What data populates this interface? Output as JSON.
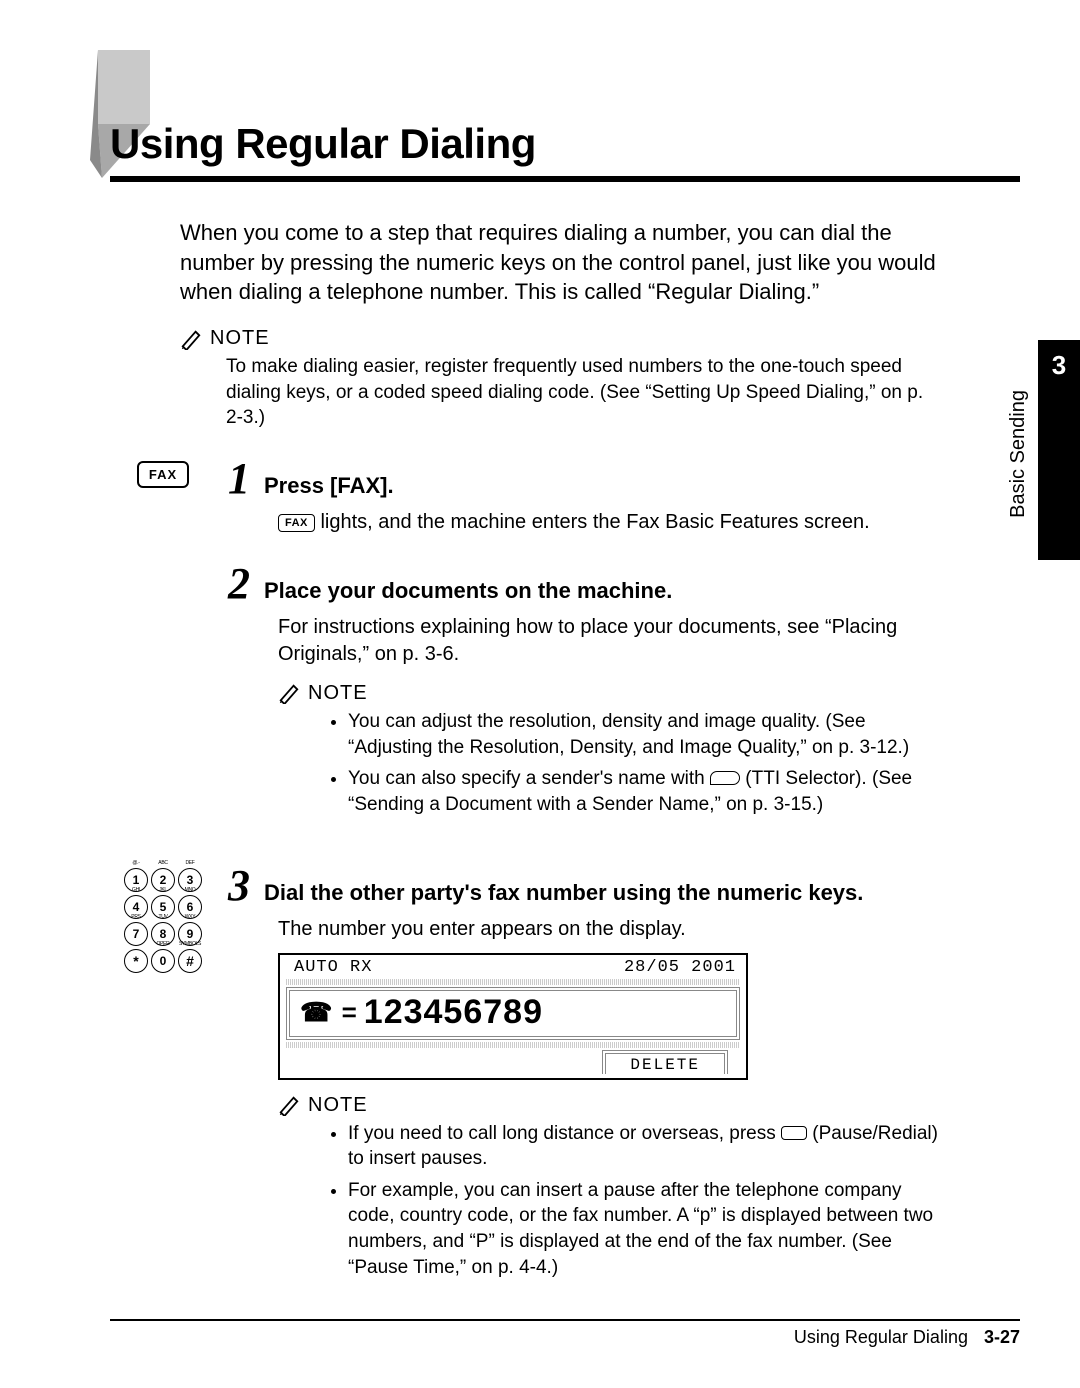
{
  "page": {
    "title": "Using Regular Dialing",
    "chapter_number": "3",
    "side_label": "Basic Sending",
    "footer_title": "Using Regular Dialing",
    "page_number": "3-27"
  },
  "intro": "When you come to a step that requires dialing a number, you can dial the number by pressing the numeric keys on the control panel, just like you would when dialing a telephone number. This is called “Regular Dialing.”",
  "note_label": "NOTE",
  "top_note": "To make dialing easier, register frequently used numbers to the one-touch speed dialing keys, or a coded speed dialing code. (See “Setting Up Speed Dialing,” on p. 2-3.)",
  "steps": [
    {
      "num": "1",
      "title": "Press [FAX].",
      "left_key_label": "FAX",
      "body_prefix_key": "FAX",
      "body_after_key": " lights, and the machine enters the Fax Basic Features screen."
    },
    {
      "num": "2",
      "title": "Place your documents on the machine.",
      "body": "For instructions explaining how to place your documents, see “Placing Originals,” on p. 3-6.",
      "note_items": [
        "You can adjust the resolution, density and image quality. (See “Adjusting the Resolution, Density, and Image Quality,” on p. 3-12.)",
        {
          "pre": "You can also specify a sender's name with ",
          "post": " (TTI Selector). (See “Sending a Document with a Sender Name,” on p. 3-15.)",
          "icon": "tti"
        }
      ]
    },
    {
      "num": "3",
      "title": "Dial the other party's fax number using the numeric keys.",
      "body": "The number you enter appears on the display.",
      "lcd": {
        "top_left": "AUTO RX",
        "top_right": "28/05 2001",
        "dial_prefix": "☎ =",
        "dial_number": "123456789",
        "softkey": "DELETE"
      },
      "note_items": [
        {
          "pre": "If you need to call long distance or overseas, press ",
          "post": " (Pause/Redial) to insert pauses.",
          "icon": "btn"
        },
        "For example, you can insert a pause after the telephone company code, country code, or the fax number. A “p” is displayed between two numbers, and “P” is displayed at the end of the fax number. (See “Pause Time,” on p. 4-4.)"
      ]
    }
  ],
  "keypad": {
    "keys": [
      "1",
      "2",
      "3",
      "4",
      "5",
      "6",
      "7",
      "8",
      "9",
      "*",
      "0",
      "#"
    ],
    "sup": [
      "@.-",
      "ABC",
      "DEF",
      "GHI",
      "JKL",
      "MNO",
      "PRS",
      "TUV",
      "WXY",
      "",
      "OPER",
      "SYMBOLS"
    ]
  }
}
